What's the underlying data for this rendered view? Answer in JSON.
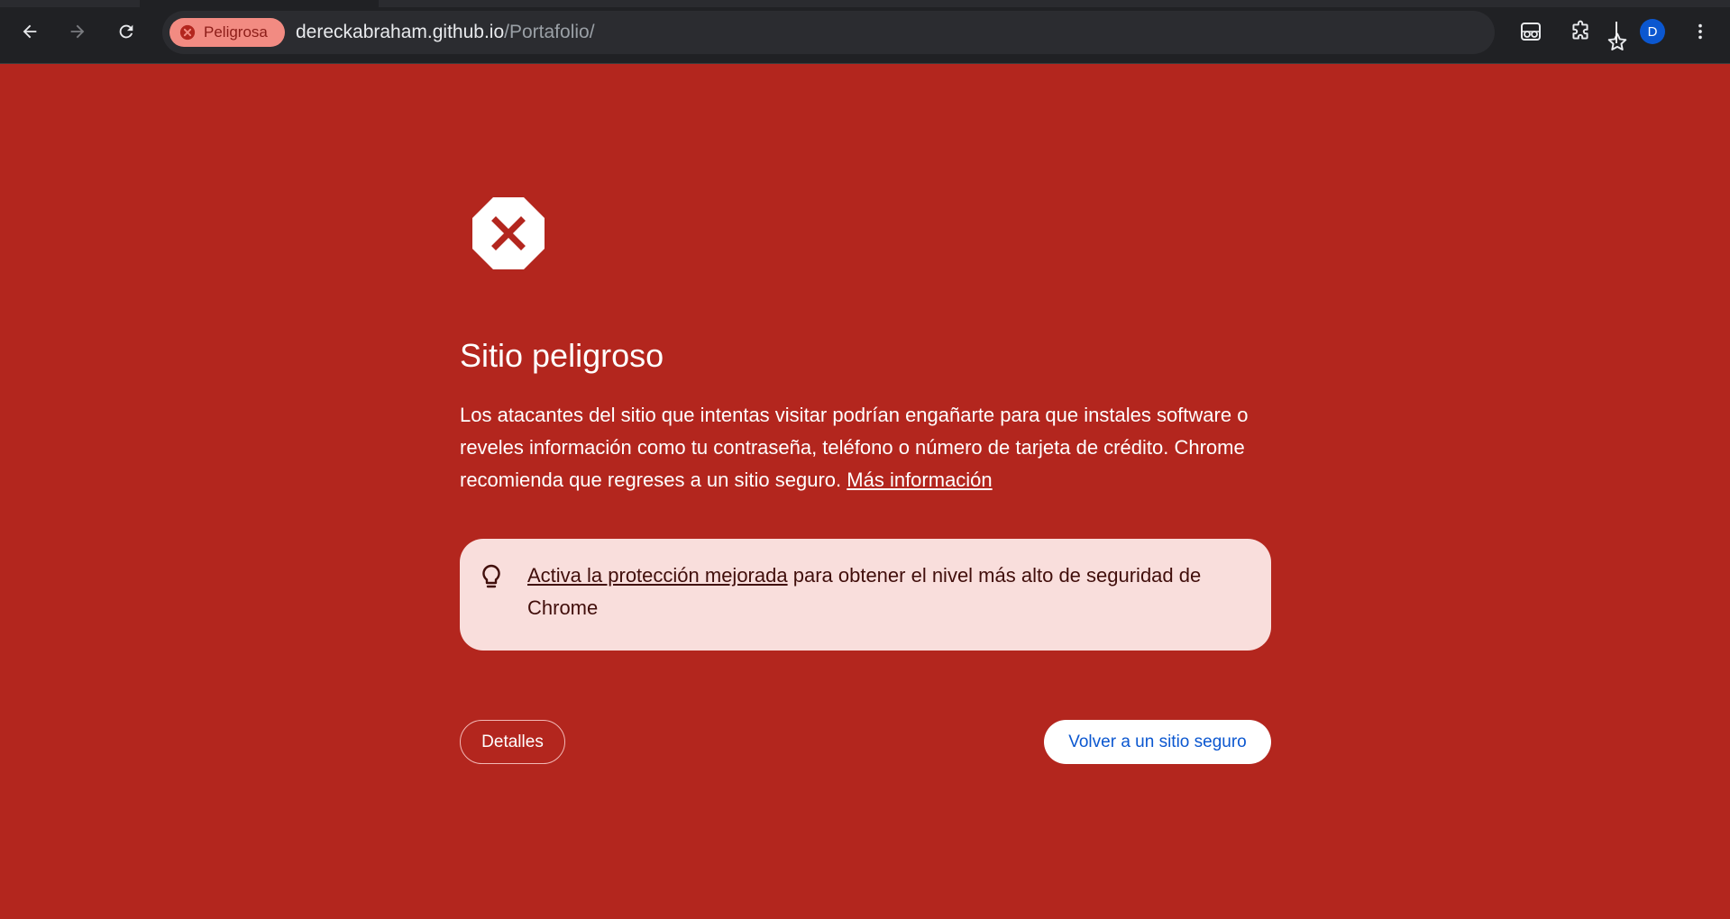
{
  "browser": {
    "security_chip_label": "Peligrosa",
    "url_host": "dereckabraham.github.io",
    "url_path": "/Portafolio/",
    "profile_initial": "D"
  },
  "interstitial": {
    "title": "Sitio peligroso",
    "description": "Los atacantes del sitio que intentas visitar podrían engañarte para que instales software o reveles información como tu contraseña, teléfono o número de tarjeta de crédito. Chrome recomienda que regreses a un sitio seguro.",
    "learn_more_link": "Más información",
    "tip_link": "Activa la protección mejorada",
    "tip_text": "para obtener el nivel más alto de seguridad de Chrome",
    "details_button": "Detalles",
    "back_button": "Volver a un sitio seguro"
  },
  "colors": {
    "page_background": "#b3261e",
    "toolbar_background": "#202124",
    "chip_background": "#f28b82",
    "tip_background": "#f9dedc",
    "link_blue": "#0b57d0"
  },
  "icons": [
    "back-arrow-icon",
    "forward-arrow-icon",
    "reload-icon",
    "danger-icon",
    "star-icon",
    "reading-mode-icon",
    "extensions-icon",
    "menu-dots-icon",
    "stop-sign-x-icon",
    "lightbulb-icon"
  ]
}
